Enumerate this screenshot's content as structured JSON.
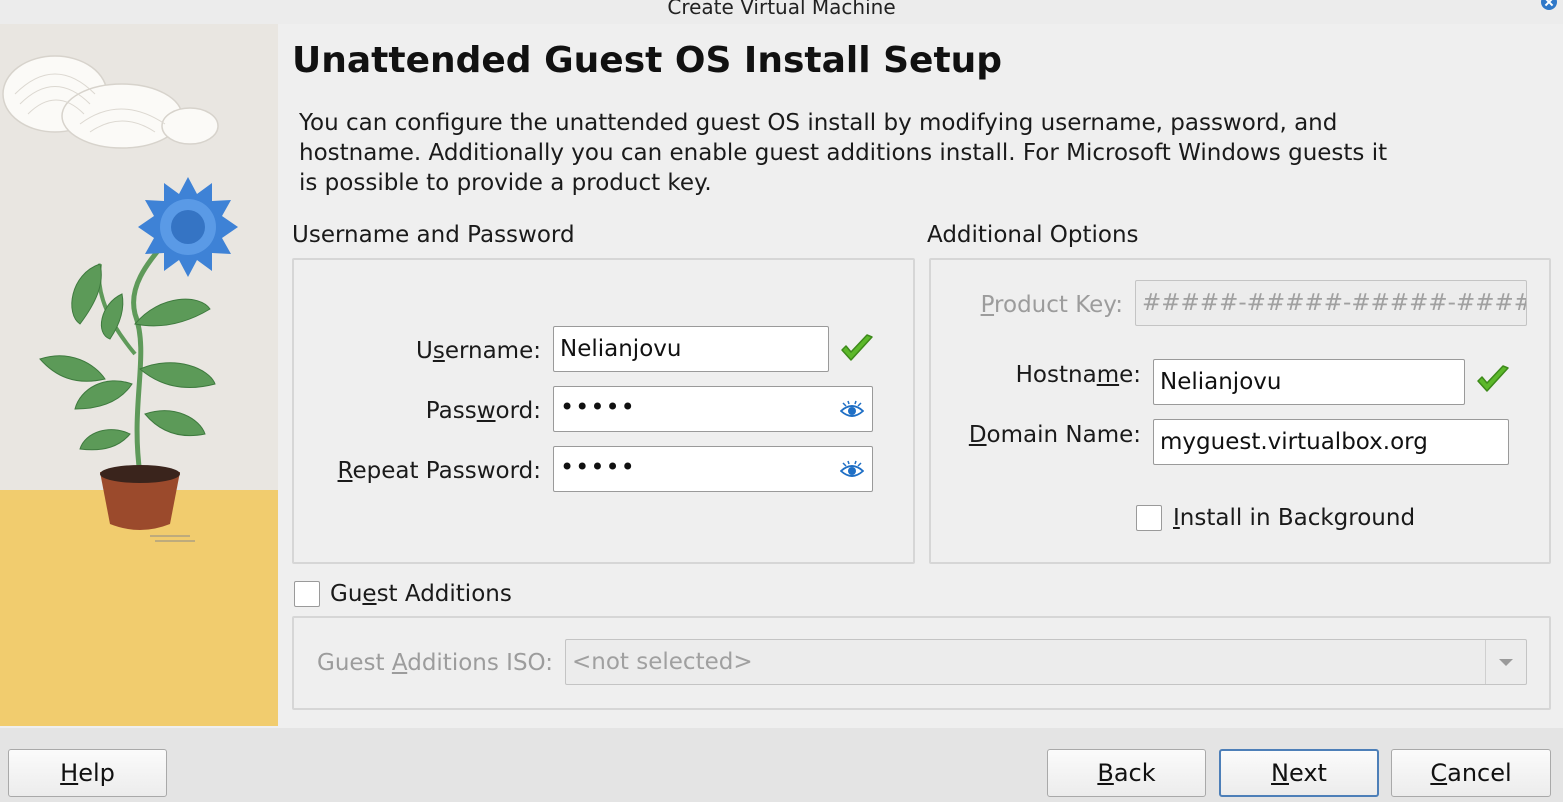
{
  "window": {
    "title": "Create Virtual Machine"
  },
  "page": {
    "heading": "Unattended Guest OS Install Setup",
    "intro": "You can configure the unattended guest OS install by modifying username, password, and hostname. Additionally you can enable guest additions install. For Microsoft Windows guests it is possible to provide a product key."
  },
  "credentials": {
    "group_title": "Username and Password",
    "username": {
      "label_pre": "U",
      "label_key": "s",
      "label_post": "ername:",
      "value": "Nelianjovu"
    },
    "password": {
      "label_pre": "Pass",
      "label_key": "w",
      "label_post": "ord:",
      "value": "•••••"
    },
    "repeat_password": {
      "label_pre": "",
      "label_key": "R",
      "label_post": "epeat Password:",
      "value": "•••••"
    }
  },
  "options": {
    "group_title": "Additional Options",
    "product_key": {
      "label_pre": "",
      "label_key": "P",
      "label_post": "roduct Key:",
      "placeholder": "#####-#####-#####-#####-#####"
    },
    "hostname": {
      "label_pre": "Hostna",
      "label_key": "m",
      "label_post": "e:",
      "value": "Nelianjovu"
    },
    "domain": {
      "label_pre": "",
      "label_key": "D",
      "label_post": "omain Name:",
      "value": "myguest.virtualbox.org"
    },
    "install_background": {
      "label_pre": "",
      "label_key": "I",
      "label_post": "nstall in Background",
      "checked": false
    }
  },
  "guest_additions": {
    "checkbox": {
      "label_pre": "Gu",
      "label_key": "e",
      "label_post": "st Additions",
      "checked": false
    },
    "iso": {
      "label_pre": "Guest ",
      "label_key": "A",
      "label_post": "dditions ISO:",
      "value": "<not selected>"
    }
  },
  "buttons": {
    "help": {
      "label_pre": "",
      "label_key": "H",
      "label_post": "elp"
    },
    "back": {
      "label_pre": "",
      "label_key": "B",
      "label_post": "ack"
    },
    "next": {
      "label_pre": "",
      "label_key": "N",
      "label_post": "ext"
    },
    "cancel": {
      "label_pre": "",
      "label_key": "C",
      "label_post": "ancel"
    }
  },
  "colors": {
    "valid_check": "#5cb82a",
    "default_button_border": "#4d7fb8",
    "eye_icon": "#1f6fc5"
  }
}
